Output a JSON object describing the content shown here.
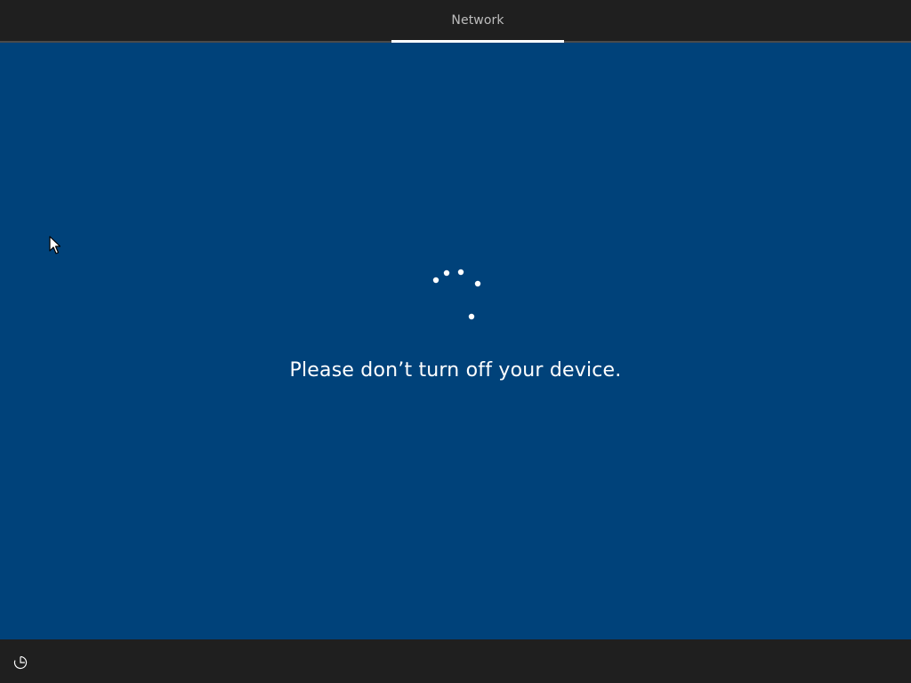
{
  "header": {
    "active_tab": "Network"
  },
  "main": {
    "message": "Please don’t turn off your device."
  },
  "colors": {
    "background": "#00427a",
    "bar": "#1f1f1f",
    "text": "#ffffff",
    "tab_text": "#bdbdbd"
  },
  "icons": {
    "spinner": "loading-dots-icon",
    "cursor": "mouse-pointer-icon",
    "bottom_left": "ease-of-access-icon"
  }
}
